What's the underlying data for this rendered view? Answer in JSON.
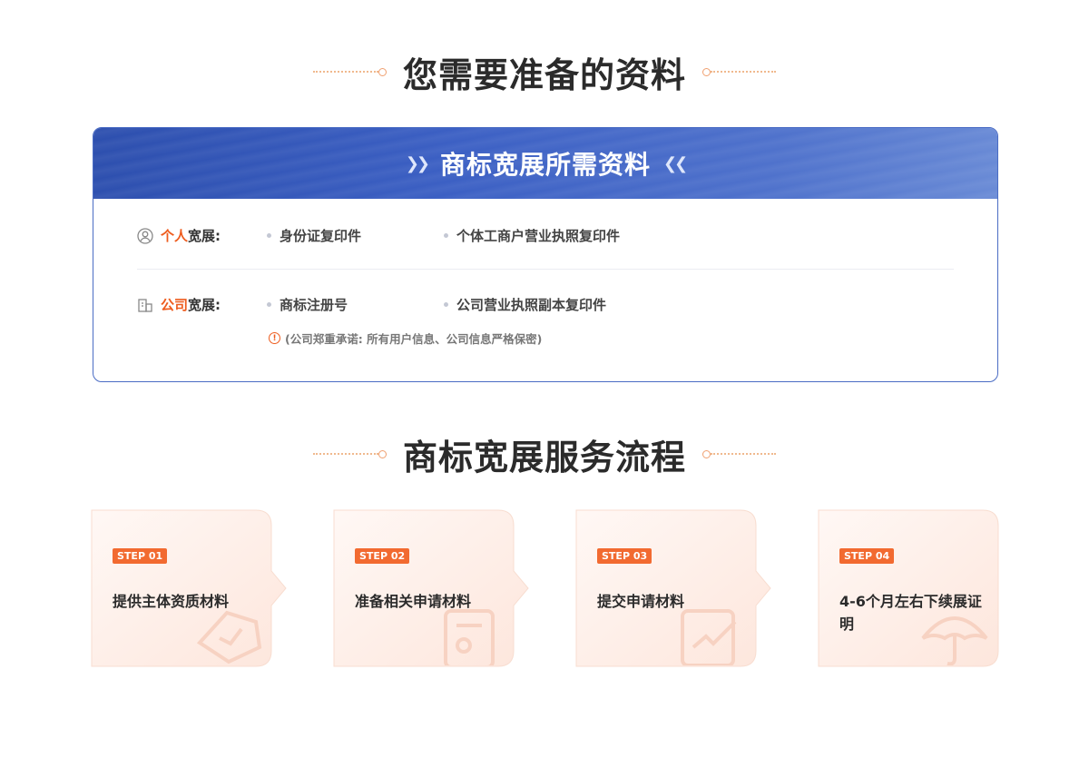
{
  "materials_title": "您需要准备的资料",
  "card": {
    "title": "商标宽展所需资料",
    "rows": [
      {
        "label_accent": "个人",
        "label_rest": "宽展:",
        "items": [
          "身份证复印件",
          "个体工商户营业执照复印件"
        ]
      },
      {
        "label_accent": "公司",
        "label_rest": "宽展:",
        "items": [
          "商标注册号",
          "公司营业执照副本复印件"
        ]
      }
    ],
    "note": "(公司郑重承诺: 所有用户信息、公司信息严格保密)"
  },
  "process_title": "商标宽展服务流程",
  "steps": [
    {
      "badge": "STEP 01",
      "title": "提供主体资质材料"
    },
    {
      "badge": "STEP 02",
      "title": "准备相关申请材料"
    },
    {
      "badge": "STEP 03",
      "title": "提交申请材料"
    },
    {
      "badge": "STEP 04",
      "title": "4-6个月左右下续展证明"
    }
  ],
  "colors": {
    "accent": "#ee5c1e",
    "badge": "#f26a30",
    "header_blue": "#3c60c4",
    "border_blue": "#4a6cc4"
  }
}
